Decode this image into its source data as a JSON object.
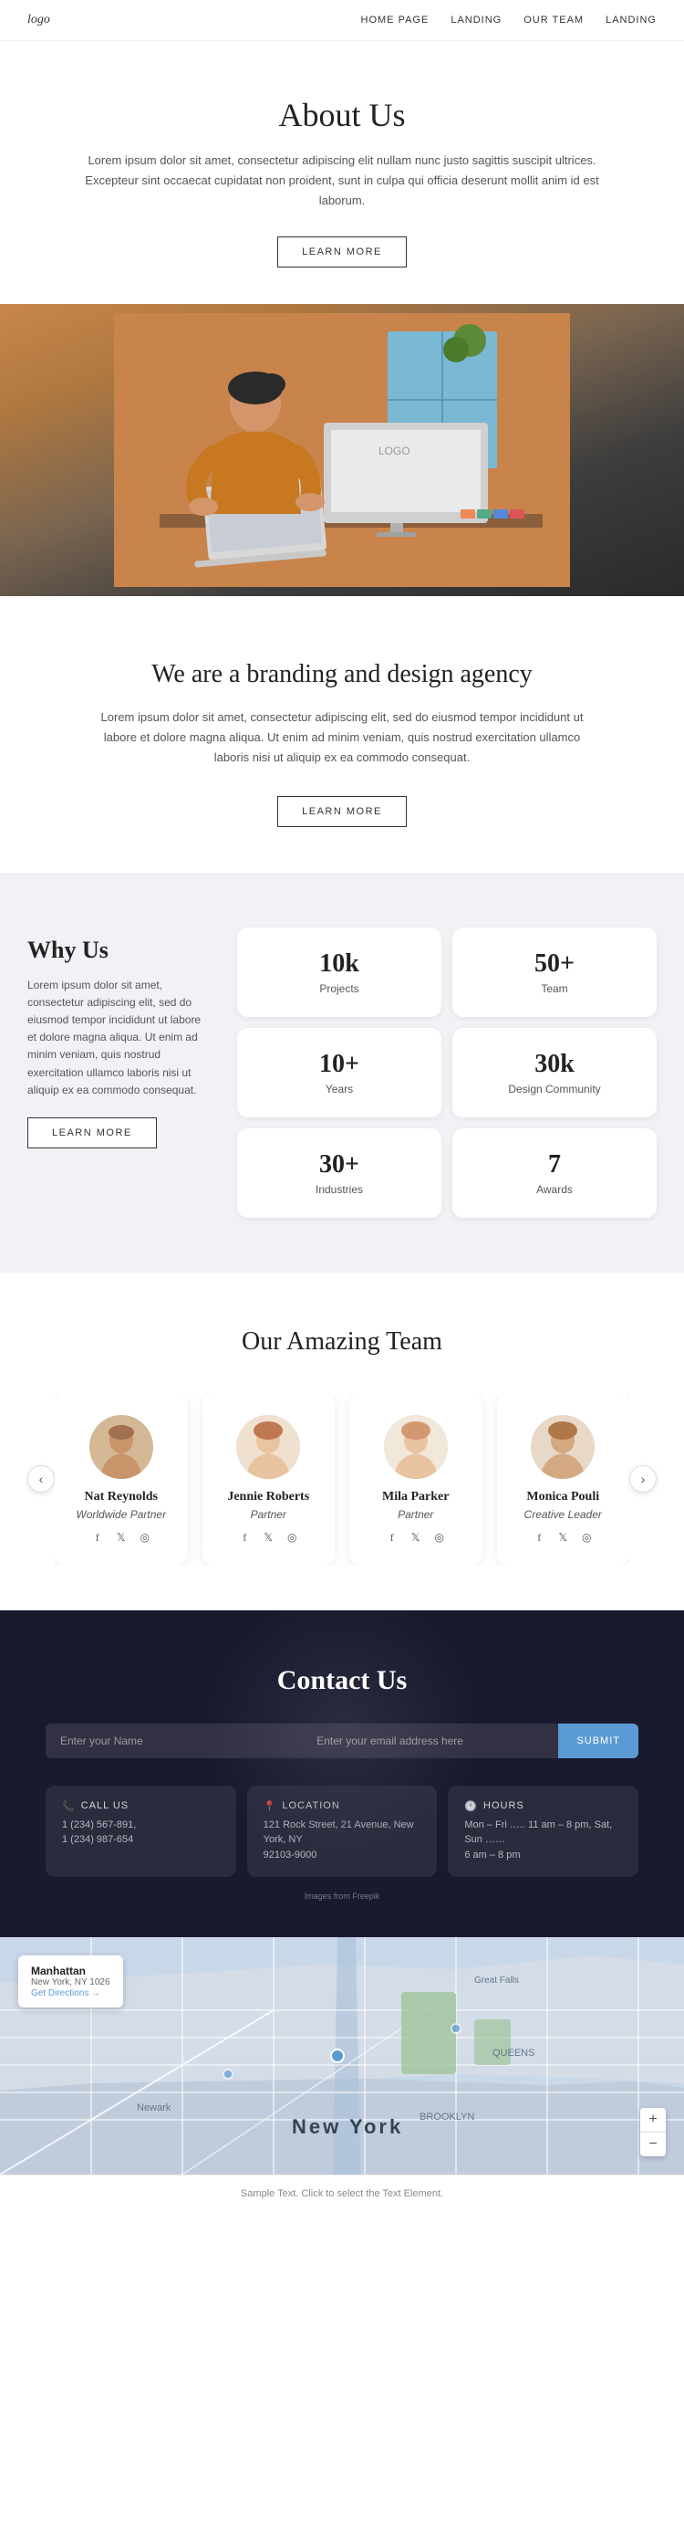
{
  "nav": {
    "logo": "logo",
    "links": [
      "HOME PAGE",
      "LANDING",
      "OUR TEAM",
      "LANDING"
    ]
  },
  "about": {
    "title": "About Us",
    "description": "Lorem ipsum dolor sit amet, consectetur adipiscing elit nullam nunc justo sagittis suscipit ultrices. Excepteur sint occaecat cupidatat non proident, sunt in culpa qui officia deserunt mollit anim id est laborum.",
    "btn_label": "LEARN MORE"
  },
  "branding": {
    "title": "We are a branding and design agency",
    "description": "Lorem ipsum dolor sit amet, consectetur adipiscing elit, sed do eiusmod tempor incididunt ut labore et dolore magna aliqua. Ut enim ad minim veniam, quis nostrud exercitation ullamco laboris nisi ut aliquip ex ea commodo consequat.",
    "btn_label": "LEARN MORE"
  },
  "why_us": {
    "title": "Why Us",
    "description": "Lorem ipsum dolor sit amet, consectetur adipiscing elit, sed do eiusmod tempor incididunt ut labore et dolore magna aliqua. Ut enim ad minim veniam, quis nostrud exercitation ullamco laboris nisi ut aliquip ex ea commodo consequat.",
    "btn_label": "LEARN MORE",
    "stats": [
      {
        "num": "10k",
        "label": "Projects"
      },
      {
        "num": "50+",
        "label": "Team"
      },
      {
        "num": "10+",
        "label": "Years"
      },
      {
        "num": "30k",
        "label": "Design Community"
      },
      {
        "num": "30+",
        "label": "Industries"
      },
      {
        "num": "7",
        "label": "Awards"
      }
    ]
  },
  "team": {
    "title": "Our Amazing Team",
    "members": [
      {
        "name": "Nat Reynolds",
        "role": "Worldwide Partner",
        "emoji": "👨"
      },
      {
        "name": "Jennie Roberts",
        "role": "Partner",
        "emoji": "👩"
      },
      {
        "name": "Mila Parker",
        "role": "Partner",
        "emoji": "👩"
      },
      {
        "name": "Monica Pouli",
        "role": "Creative Leader",
        "emoji": "👩"
      }
    ],
    "social": [
      "f",
      "𝕏",
      "in"
    ]
  },
  "contact": {
    "title": "Contact Us",
    "name_placeholder": "Enter your Name",
    "email_placeholder": "Enter your email address here",
    "btn_label": "SUBMIT",
    "cards": [
      {
        "icon": "📞",
        "title": "CALL US",
        "lines": [
          "1 (234) 567-891,",
          "1 (234) 987-654"
        ]
      },
      {
        "icon": "📍",
        "title": "LOCATION",
        "lines": [
          "121 Rock Street, 21 Avenue, New York, NY",
          "92103-9000"
        ]
      },
      {
        "icon": "🕐",
        "title": "HOURS",
        "lines": [
          "Mon – Fri ….. 11 am – 8 pm, Sat, Sun ……",
          "6 am – 8 pm"
        ]
      }
    ],
    "credit": "Images from Freepik"
  },
  "map": {
    "city": "Manhattan",
    "addr": "New York, NY 1026",
    "link": "Get Directions →",
    "label": "New York"
  },
  "footer": {
    "text": "Sample Text. Click to select the Text Element."
  }
}
